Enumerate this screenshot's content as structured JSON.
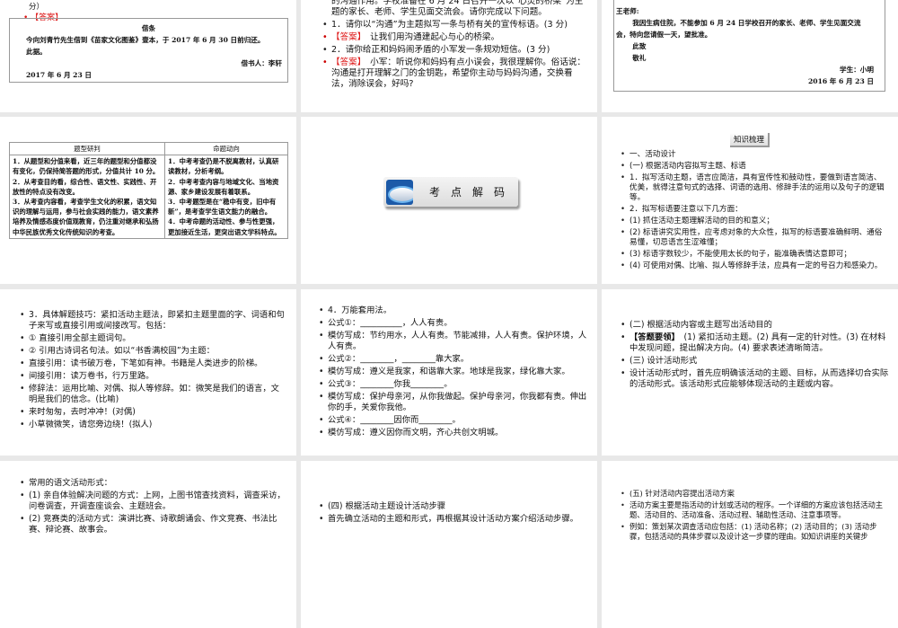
{
  "slide1": {
    "partial": "分）",
    "answer_label": "【答案】",
    "note": {
      "title": "借条",
      "body": "今向刘青竹先生借到《苗家文化图鉴》壹本，于 2017 年 6 月 30 日前归还。",
      "closing": "此据。",
      "signer": "借书人：李轩",
      "date": "2017 年 6 月 23 日"
    }
  },
  "slide2": {
    "items": [
      {
        "text": "的沟通作用。学校准备在 6 月 24 日召开一次以“心灵的桥梁”为主题的家长、老师、学生见面交流会。请你完成以下问题。",
        "nobullet": true
      },
      {
        "text": "1．请你以“沟通”为主题拟写一条与桥有关的宣传标语。(3 分)"
      },
      {
        "label": "【答案】",
        "text": "　让我们用沟通建起心与心的桥梁。"
      },
      {
        "text": "2．请你给正和妈妈闹矛盾的小军发一条规劝短信。(3 分)"
      },
      {
        "label": "【答案】",
        "text": "　小军：听说你和妈妈有点小误会，我很理解你。俗话说：沟通是打开理解之门的金钥匙，希望你主动与妈妈沟通，交换看法，消除误会，好吗?"
      }
    ]
  },
  "slide3": {
    "greeting": "王老师:",
    "body": "我因生病住院，不能参加 6 月 24 日学校召开的家长、老师、学生见面交流会，特向您请假一天，望批准。",
    "closing1": "此致",
    "closing2": "敬礼",
    "signer": "学生：小明",
    "date": "2016 年 6 月 23 日"
  },
  "slide4": {
    "headers": [
      "题型研判",
      "命题动向"
    ],
    "col1": "1．从题型和分值来看，近三年的题型和分值都没有变化，仍保持简答题的形式，分值共计 10 分。\n2．从考查目的看，综合性、语文性、实践性、开放性的特点没有改变。\n3．从考查内容看，考查学生文化的积累，语文知识的理解与运用，参与社会实践的能力，语文素养培养及情感态度价值观教育，仍注重对继承和弘扬中华民族优秀文化传统知识的考查。",
    "col2": "1．中考考查仍是不脱离教材，认真研读教材，分析考纲。\n2．中考考查内容与地域文化、当地资源、家乡建设发展有着联系。\n3．中考题型是在“稳中有变，旧中有新”，是考查学生语文能力的融合。\n4．中考命题的活动性、参与性更强，更加接近生活，更突出语文学科特点。"
  },
  "slide5": {
    "button_label": "考点解码"
  },
  "slide6": {
    "tag": "知识梳理",
    "items": [
      {
        "text": "一、活动设计"
      },
      {
        "text": "(一) 根据活动内容拟写主题、标语"
      },
      {
        "text": "1．拟写活动主题，语言应简洁，具有宣传性和鼓动性，要做到语言简洁、优美，就得注意句式的选择、词语的选用、修辞手法的运用以及句子的逻辑等。"
      },
      {
        "text": "2．拟写标语要注意以下几方面："
      },
      {
        "text": "(1) 抓住活动主题理解活动的目的和意义；"
      },
      {
        "text": "(2) 标语讲究实用性，应考虑对象的大众性，拟写的标语要准确鲜明、通俗易懂，切忌语言生涩难懂；"
      },
      {
        "text": "(3) 标语字数较少，不能使用太长的句子，能准确表情达意即可；"
      },
      {
        "text": "(4) 可使用对偶、比喻、拟人等修辞手法，应具有一定的号召力和感染力。"
      }
    ]
  },
  "slide7": {
    "items": [
      {
        "text": "3．具体解题技巧：紧扣活动主题法，即紧扣主题里面的字、词语和句子来写或直接引用或间接改写。包括："
      },
      {
        "text": "① 直接引用全部主题词句。"
      },
      {
        "text": "② 引用古诗词名句法。如以“书香满校园”为主题："
      },
      {
        "text": "直接引用：读书破万卷，下笔如有神。书籍是人类进步的阶梯。"
      },
      {
        "text": "间接引用：读万卷书，行万里路。"
      },
      {
        "text": "修辞法：运用比喻、对偶、拟人等修辞。如：微笑是我们的语言，文明是我们的信念。(比喻)"
      },
      {
        "text": "来时匆匆，去时冲冲！(对偶)"
      },
      {
        "text": "小草微微笑，请您旁边绕！(拟人)"
      }
    ]
  },
  "slide8": {
    "items": [
      {
        "text": "4．万能套用法。"
      },
      {
        "text": "公式①：__________，人人有责。"
      },
      {
        "text": "模仿写成：节约用水，人人有责。节能减排，人人有责。保护环境，人人有责。"
      },
      {
        "text": "公式②：________，________靠大家。"
      },
      {
        "text": "模仿写成：遵义是我家，和谐靠大家。地球是我家，绿化靠大家。"
      },
      {
        "text": "公式③：________你我________。"
      },
      {
        "text": "模仿写成：保护母亲河，从你我做起。保护母亲河，你我都有责。伸出你的手，关爱你我他。"
      },
      {
        "text": "公式④：________因你而________。"
      },
      {
        "text": "模仿写成：遵义因你而文明，齐心共创文明城。"
      }
    ]
  },
  "slide9": {
    "items": [
      {
        "text": "(二) 根据活动内容或主题写出活动目的"
      },
      {
        "label": "【答题要领】",
        "labelBlack": true,
        "text": "　(1) 紧扣活动主题。(2) 具有一定的针对性。(3) 在材料中发现问题，提出解决方向。(4) 要求表述清晰简洁。"
      },
      {
        "text": "(三) 设计活动形式"
      },
      {
        "text": "设计活动形式时，首先应明确该活动的主题、目标，从而选择切合实际的活动形式。该活动形式应能够体现活动的主题或内容。"
      }
    ]
  },
  "slide10": {
    "items": [
      {
        "text": "常用的语文活动形式："
      },
      {
        "text": "(1) 亲自体验解决问题的方式：上网，上图书馆查找资料，调查采访，问卷调查，开调查座谈会、主题班会。"
      },
      {
        "text": "(2) 竞赛类的活动方式：演讲比赛、诗歌朗诵会、作文竞赛、书法比赛、辩论赛、故事会。"
      }
    ]
  },
  "slide11": {
    "items": [
      {
        "text": "(四) 根据活动主题设计活动步骤"
      },
      {
        "text": "首先确立活动的主题和形式，再根据其设计活动方案介绍活动步骤。"
      }
    ]
  },
  "slide12": {
    "items": [
      {
        "text": "(五) 针对活动内容提出活动方案"
      },
      {
        "text": "活动方案主要是指活动的计划或活动的程序。一个详细的方案应该包括活动主题、活动目的、活动准备、活动过程、辅助性活动、注意事项等。"
      },
      {
        "text": "例如：策划某次调查活动应包括：(1) 活动名称；(2) 活动目的；(3) 活动步骤，包括活动的具体步骤以及设计这一步骤的理由。如知识讲座的关键步"
      }
    ]
  }
}
